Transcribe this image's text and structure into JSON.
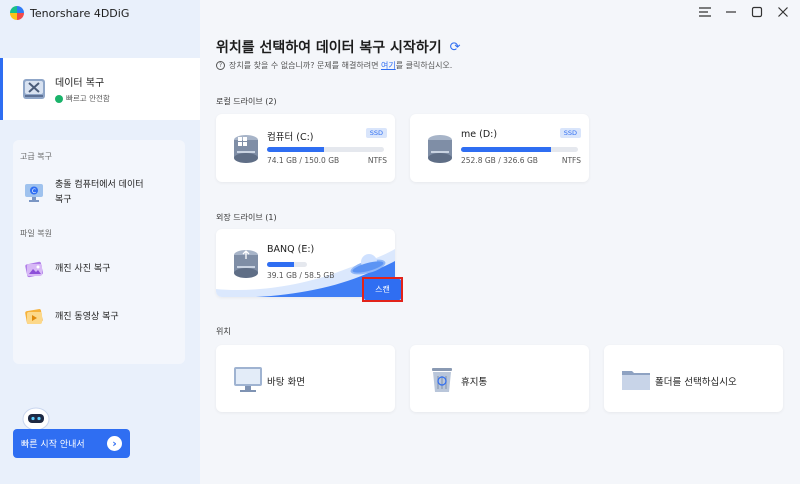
{
  "app": {
    "name": "Tenorshare 4DDiG"
  },
  "sidebar": {
    "active": {
      "title": "데이터 복구",
      "subtitle": "빠르고 안전함"
    },
    "advanced_label": "고급 복구",
    "advanced_items": [
      {
        "label_line1": "충돌 컴퓨터에서 데이터",
        "label_line2": "복구"
      }
    ],
    "repair_label": "파일 복원",
    "repair_items": [
      {
        "label": "깨진 사진 복구"
      },
      {
        "label": "깨진 동영상 복구"
      }
    ],
    "quick_start": "빠른 시작 안내서"
  },
  "main": {
    "title": "위치를 선택하여 데이터 복구 시작하기",
    "help_prefix": "장치를 찾을 수 없습니까? 문제를 해결하려면",
    "help_link": "여기",
    "help_suffix": "를 클릭하십시오.",
    "local_section": "로컬 드라이브 (2)",
    "local_drives": [
      {
        "name": "컴퓨터 (C:)",
        "badge": "SSD",
        "size": "74.1 GB / 150.0 GB",
        "fs": "NTFS",
        "usage": 0.494
      },
      {
        "name": "me (D:)",
        "badge": "SSD",
        "size": "252.8 GB / 326.6 GB",
        "fs": "NTFS",
        "usage": 0.774
      }
    ],
    "external_section": "외장 드라이브 (1)",
    "external_drives": [
      {
        "name": "BANQ (E:)",
        "size": "39.1 GB / 58.5 GB",
        "usage": 0.668,
        "scan_label": "스캔"
      }
    ],
    "location_section": "위치",
    "locations": [
      {
        "label": "바탕 화면"
      },
      {
        "label": "휴지통"
      },
      {
        "label": "폴더를 선택하십시오"
      }
    ]
  }
}
